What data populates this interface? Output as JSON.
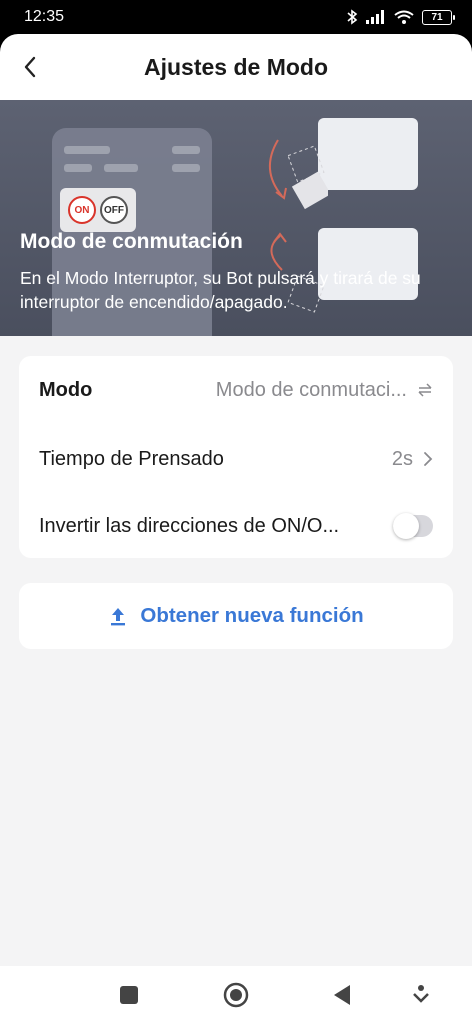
{
  "status_bar": {
    "time": "12:35",
    "battery": "71"
  },
  "header": {
    "title": "Ajustes de Modo"
  },
  "hero": {
    "title": "Modo de conmutación",
    "description": "En el Modo Interruptor, su Bot pulsará y tirará de su interruptor de encendido/apagado.",
    "switch_on": "ON",
    "switch_off": "OFF"
  },
  "settings": {
    "mode_label": "Modo",
    "mode_value": "Modo de conmutaci...",
    "press_time_label": "Tiempo de Prensado",
    "press_time_value": "2s",
    "invert_label": "Invertir las direcciones de ON/O...",
    "invert_enabled": false
  },
  "feature": {
    "label": "Obtener nueva función"
  },
  "colors": {
    "accent": "#3a78d6",
    "hero_bg": "#545968",
    "switch_on": "#d9342b"
  }
}
